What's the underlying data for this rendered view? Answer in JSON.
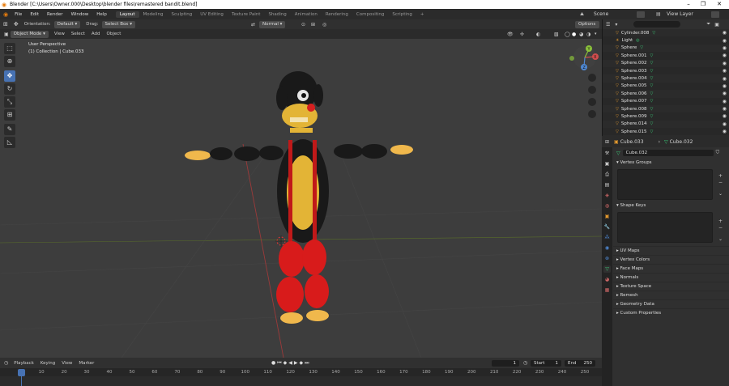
{
  "window": {
    "title": "Blender [C:\\Users\\Owner.000\\Desktop\\blender files\\remastered bandit.blend]",
    "minimize": "–",
    "maximize": "❐",
    "close": "✕"
  },
  "menu": {
    "items": [
      "File",
      "Edit",
      "Render",
      "Window",
      "Help"
    ],
    "workspaces": [
      "Layout",
      "Modeling",
      "Sculpting",
      "UV Editing",
      "Texture Paint",
      "Shading",
      "Animation",
      "Rendering",
      "Compositing",
      "Scripting"
    ],
    "active_workspace": "Layout",
    "add_workspace": "+",
    "scene_label": "Scene",
    "view_layer_label": "View Layer"
  },
  "viewport_header": {
    "orientation_label": "Orientation:",
    "orientation_value": "Default",
    "drag_label": "Drag:",
    "drag_value": "Select Box",
    "pivot_value": "Normal",
    "options_label": "Options",
    "mode": "Object Mode",
    "menu": [
      "View",
      "Select",
      "Add",
      "Object"
    ]
  },
  "viewport": {
    "perspective": "User Perspective",
    "collection": "(1) Collection | Cube.033",
    "gizmo_axes": [
      "X",
      "Y",
      "Z"
    ],
    "bg_color": "#3d3d3d",
    "grid_x_color": "#9b3a3a",
    "grid_y_color": "#6b8a23"
  },
  "outliner": {
    "rows": [
      {
        "name": "Cylinder.008",
        "kind": "mesh"
      },
      {
        "name": "Light",
        "kind": "light"
      },
      {
        "name": "Sphere",
        "kind": "mesh"
      },
      {
        "name": "Sphere.001",
        "kind": "mesh"
      },
      {
        "name": "Sphere.002",
        "kind": "mesh"
      },
      {
        "name": "Sphere.003",
        "kind": "mesh"
      },
      {
        "name": "Sphere.004",
        "kind": "mesh"
      },
      {
        "name": "Sphere.005",
        "kind": "mesh"
      },
      {
        "name": "Sphere.006",
        "kind": "mesh"
      },
      {
        "name": "Sphere.007",
        "kind": "mesh"
      },
      {
        "name": "Sphere.008",
        "kind": "mesh"
      },
      {
        "name": "Sphere.009",
        "kind": "mesh"
      },
      {
        "name": "Sphere.014",
        "kind": "mesh"
      },
      {
        "name": "Sphere.015",
        "kind": "mesh"
      }
    ]
  },
  "properties": {
    "object_name": "Cube.033",
    "mesh_name": "Cube.032",
    "data_field": "Cube.032",
    "vertex_groups": "Vertex Groups",
    "shape_keys": "Shape Keys",
    "sections": [
      "UV Maps",
      "Vertex Colors",
      "Face Maps",
      "Normals",
      "Texture Space",
      "Remesh",
      "Geometry Data",
      "Custom Properties"
    ]
  },
  "timeline": {
    "menu": [
      "Playback",
      "Keying",
      "View",
      "Marker"
    ],
    "current_frame": "1",
    "start_label": "Start",
    "start_value": "1",
    "end_label": "End",
    "end_value": "250",
    "ticks": [
      "1",
      "10",
      "20",
      "30",
      "40",
      "50",
      "60",
      "70",
      "80",
      "90",
      "100",
      "110",
      "120",
      "130",
      "140",
      "150",
      "160",
      "170",
      "180",
      "190",
      "200",
      "210",
      "220",
      "230",
      "240",
      "250"
    ]
  },
  "colors": {
    "accent": "#4772b3",
    "mesh_icon": "#e59a2e",
    "modifier_icon": "#3bd47c"
  }
}
